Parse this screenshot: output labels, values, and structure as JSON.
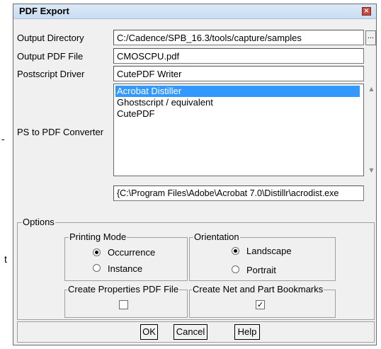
{
  "outside": {
    "frag1": "-",
    "frag2": "t"
  },
  "dialog": {
    "title": "PDF Export",
    "close_glyph": "×",
    "output_directory": {
      "label": "Output Directory",
      "value": "C:/Cadence/SPB_16.3/tools/capture/samples",
      "browse_label": "..."
    },
    "output_pdf_file": {
      "label": "Output PDF File",
      "value": "CMOSCPU.pdf"
    },
    "postscript_driver": {
      "label": "Postscript Driver",
      "value": "CutePDF Writer"
    },
    "ps_to_pdf_converter": {
      "label": "PS to PDF Converter",
      "items": [
        "Acrobat Distiller",
        "Ghostscript / equivalent",
        "CutePDF"
      ],
      "selected_index": 0,
      "command": "{C:\\Program Files\\Adobe\\Acrobat 7.0\\Distillr\\acrodist.exe"
    },
    "options": {
      "label": "Options",
      "printing_mode": {
        "label": "Printing Mode",
        "occurrence": "Occurrence",
        "instance": "Instance",
        "selected": "Occurrence"
      },
      "orientation": {
        "label": "Orientation",
        "landscape": "Landscape",
        "portrait": "Portrait",
        "selected": "Landscape"
      },
      "create_properties": {
        "label": "Create Properties PDF File",
        "checked": false
      },
      "create_bookmarks": {
        "label": "Create Net and Part Bookmarks",
        "checked": true,
        "check_glyph": "✓"
      }
    },
    "buttons": {
      "ok": "OK",
      "cancel": "Cancel",
      "help": "Help"
    }
  }
}
